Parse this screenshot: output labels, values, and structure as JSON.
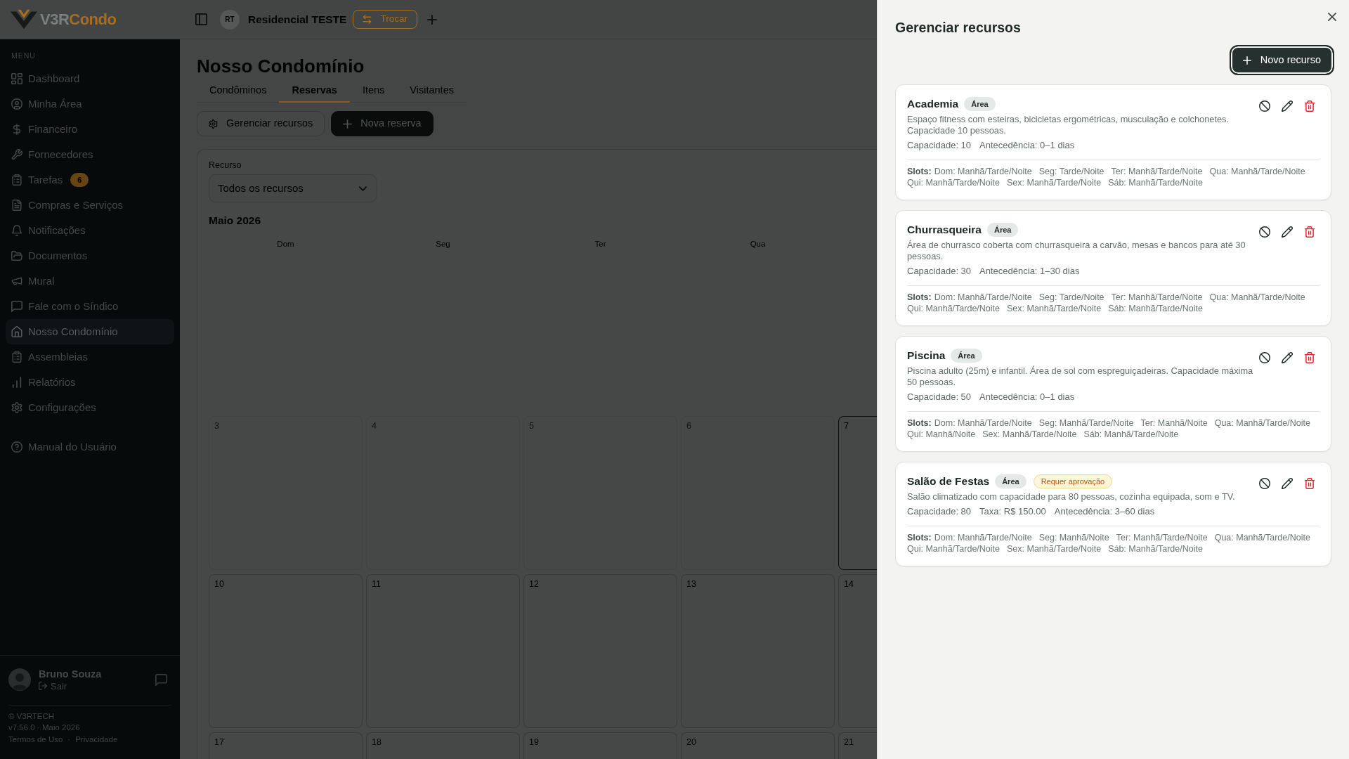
{
  "header": {
    "brand": {
      "name": "V3R",
      "accent": "Condo"
    },
    "condominium": {
      "initials": "RT",
      "name": "Residencial TESTE"
    },
    "switch_button": "Trocar"
  },
  "sidebar": {
    "section_label": "MENU",
    "items": [
      {
        "label": "Dashboard",
        "selected": false
      },
      {
        "label": "Minha Área",
        "selected": false
      },
      {
        "label": "Financeiro",
        "selected": false
      },
      {
        "label": "Fornecedores",
        "selected": false
      },
      {
        "label": "Tarefas",
        "selected": false,
        "badge": "6"
      },
      {
        "label": "Compras e Serviços",
        "selected": false
      },
      {
        "label": "Notificações",
        "selected": false
      },
      {
        "label": "Documentos",
        "selected": false
      },
      {
        "label": "Mural",
        "selected": false
      },
      {
        "label": "Fale com o Síndico",
        "selected": false
      },
      {
        "label": "Nosso Condomínio",
        "selected": true
      },
      {
        "label": "Assembleias",
        "selected": false
      },
      {
        "label": "Relatórios",
        "selected": false
      },
      {
        "label": "Configurações",
        "selected": false
      }
    ],
    "help_item": {
      "label": "Manual do Usuário",
      "selected": false
    },
    "user": {
      "name": "Bruno Souza",
      "logout": "Sair"
    },
    "footer": {
      "copyright": "© V3RTECH",
      "version": "v7.56.0 · Maio 2026",
      "links": [
        "Termos de Uso",
        "Privacidade"
      ],
      "link_separator": "·"
    }
  },
  "page": {
    "title": "Nosso Condomínio",
    "tabs": [
      {
        "label": "Condôminos",
        "selected": false
      },
      {
        "label": "Reservas",
        "selected": true
      },
      {
        "label": "Itens",
        "selected": false
      },
      {
        "label": "Visitantes",
        "selected": false
      }
    ],
    "actions": [
      {
        "label": "Gerenciar recursos",
        "kind": "outline"
      },
      {
        "label": "Nova reserva",
        "kind": "primary"
      }
    ],
    "filter": {
      "label": "Recurso",
      "value": "Todos os recursos"
    },
    "calendar": {
      "month": "Maio 2026",
      "weekdays": [
        "Dom",
        "Seg",
        "Ter",
        "Qua"
      ],
      "weeks": [
        {
          "days": [
            {
              "day": "3",
              "past": true,
              "today": false
            },
            {
              "day": "4",
              "past": true,
              "today": false
            },
            {
              "day": "5",
              "past": true,
              "today": false
            },
            {
              "day": "6",
              "past": true,
              "today": false
            },
            {
              "day": "7",
              "past": false,
              "today": true
            }
          ]
        },
        {
          "days": [
            {
              "day": "10",
              "past": false,
              "today": false
            },
            {
              "day": "11",
              "past": false,
              "today": false
            },
            {
              "day": "12",
              "past": false,
              "today": false
            },
            {
              "day": "13",
              "past": false,
              "today": false
            },
            {
              "day": "14",
              "past": false,
              "today": false
            }
          ]
        },
        {
          "days": [
            {
              "day": "17",
              "past": false,
              "today": false
            },
            {
              "day": "18",
              "past": false,
              "today": false
            },
            {
              "day": "19",
              "past": false,
              "today": false
            },
            {
              "day": "20",
              "past": false,
              "today": false
            },
            {
              "day": "21",
              "past": false,
              "today": false
            }
          ]
        }
      ]
    }
  },
  "panel": {
    "title": "Gerenciar recursos",
    "new_button": "Novo recurso",
    "resources": [
      {
        "name": "Academia",
        "tags": [
          {
            "label": "Área",
            "kind": "type"
          }
        ],
        "description": "Espaço fitness com esteiras, bicicletas ergométricas, musculação e colchonetes. Capacidade 10 pessoas.",
        "details": [
          "Capacidade: 10",
          "Antecedência: 0–1 dias"
        ],
        "slots_label": "Slots:",
        "slots": [
          "Dom: Manhã/Tarde/Noite",
          "Seg: Tarde/Noite",
          "Ter: Manhã/Tarde/Noite",
          "Qua: Manhã/Tarde/Noite",
          "Qui: Manhã/Tarde/Noite",
          "Sex: Manhã/Tarde/Noite",
          "Sáb: Manhã/Tarde/Noite"
        ]
      },
      {
        "name": "Churrasqueira",
        "tags": [
          {
            "label": "Área",
            "kind": "type"
          }
        ],
        "description": "Área de churrasco coberta com churrasqueira a carvão, mesas e bancos para até 30 pessoas.",
        "details": [
          "Capacidade: 30",
          "Antecedência: 1–30 dias"
        ],
        "slots_label": "Slots:",
        "slots": [
          "Dom: Manhã/Tarde/Noite",
          "Seg: Tarde/Noite",
          "Ter: Manhã/Tarde/Noite",
          "Qua: Manhã/Tarde/Noite",
          "Qui: Manhã/Tarde/Noite",
          "Sex: Manhã/Tarde/Noite",
          "Sáb: Manhã/Tarde/Noite"
        ]
      },
      {
        "name": "Piscina",
        "tags": [
          {
            "label": "Área",
            "kind": "type"
          }
        ],
        "description": "Piscina adulto (25m) e infantil. Área de sol com espreguiçadeiras. Capacidade máxima 50 pessoas.",
        "details": [
          "Capacidade: 50",
          "Antecedência: 0–1 dias"
        ],
        "slots_label": "Slots:",
        "slots": [
          "Dom: Manhã/Tarde/Noite",
          "Seg: Manhã/Tarde/Noite",
          "Ter: Manhã/Noite",
          "Qua: Manhã/Tarde/Noite",
          "Qui: Manhã/Noite",
          "Sex: Manhã/Tarde/Noite",
          "Sáb: Manhã/Tarde/Noite"
        ]
      },
      {
        "name": "Salão de Festas",
        "tags": [
          {
            "label": "Área",
            "kind": "type"
          },
          {
            "label": "Requer aprovação",
            "kind": "approval"
          }
        ],
        "description": "Salão climatizado com capacidade para 80 pessoas, cozinha equipada, som e TV.",
        "details": [
          "Capacidade: 80",
          "Taxa: R$ 150.00",
          "Antecedência: 3–60 dias"
        ],
        "slots_label": "Slots:",
        "slots": [
          "Dom: Manhã/Tarde/Noite",
          "Seg: Manhã/Noite",
          "Ter: Manhã/Tarde/Noite",
          "Qua: Manhã/Tarde/Noite",
          "Qui: Manhã/Tarde/Noite",
          "Sex: Manhã/Tarde/Noite",
          "Sáb: Manhã/Tarde/Noite"
        ]
      }
    ]
  }
}
